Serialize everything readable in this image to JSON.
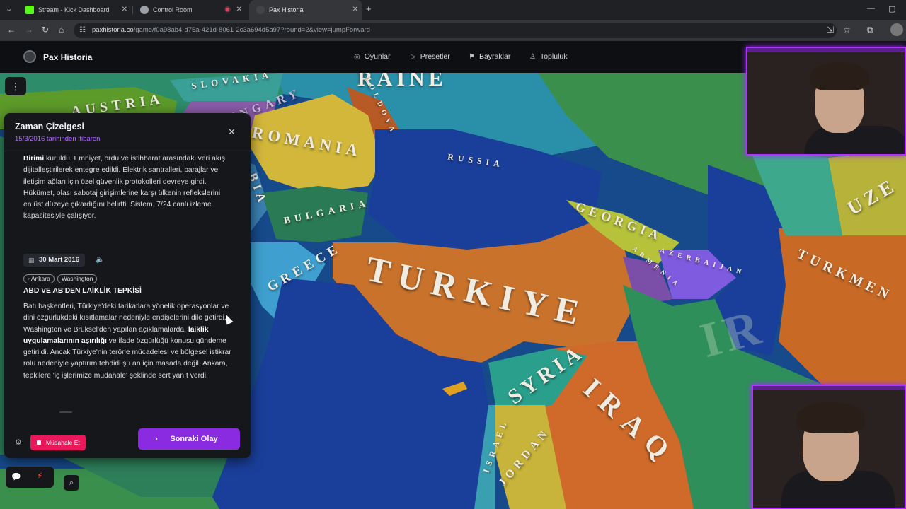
{
  "browser": {
    "tabs": [
      {
        "title": "Stream - Kick Dashboard",
        "favicon_color": "#53fc18"
      },
      {
        "title": "Control Room",
        "favicon_color": "#9aa0a6"
      },
      {
        "title": "Pax Historia",
        "favicon_color": "#444444"
      }
    ],
    "url_host": "paxhistoria.co",
    "url_path": "/game/f0a98ab4-d75a-421d-8061-2c3a694d5a97?round=2&view=jumpForward"
  },
  "app": {
    "brand": "Pax Historia",
    "nav": [
      {
        "label": "Oyunlar",
        "icon": "gamepad-icon"
      },
      {
        "label": "Presetler",
        "icon": "play-icon"
      },
      {
        "label": "Bayraklar",
        "icon": "flag-icon"
      },
      {
        "label": "Topluluk",
        "icon": "users-icon"
      }
    ]
  },
  "map_labels": {
    "ukraine": "RAINE",
    "slovakia": "SLOVAKIA",
    "austria": "AUSTRIA",
    "hungary": "HUNGARY",
    "moldova": "MOLDOVA",
    "romania": "ROMANIA",
    "russia": "RUSSIA",
    "serbia": "BIA",
    "bulgaria": "BULGARIA",
    "georgia": "GEORGIA",
    "armenia": "ARMENIA",
    "azerbaijan": "AZERBAIJAN",
    "greece": "GREECE",
    "turkiye": "TURKIYE",
    "syria": "SYRIA",
    "iraq": "IRAQ",
    "israel": "ISRAEL",
    "jordan": "JORDAN",
    "turkmen": "TURKMEN",
    "uzbek": "UZE",
    "iran": "IR"
  },
  "timeline": {
    "title": "Zaman Çizelgesi",
    "subtitle": "15/3/2016 tarihinden itibaren",
    "prev_event_bold": "Birimi",
    "prev_event_text": " kuruldu. Emniyet, ordu ve istihbarat arasındaki veri akışı dijitalleştirilerek entegre edildi. Elektrik santralleri, barajlar ve iletişim ağları için özel güvenlik protokolleri devreye girdi. Hükümet, olası sabotaj girişimlerine karşı ülkenin reflekslerini en üst düzeye çıkardığını belirtti. Sistem, 7/24 canlı izleme kapasitesiyle çalışıyor.",
    "event_date": "30 Mart 2016",
    "event_tags": [
      "Ankara",
      "Washington"
    ],
    "event_title": "ABD VE AB'DEN LAİKLİK TEPKİSİ",
    "event_text_1": "Batı başkentleri, Türkiye'deki tarikatlara yönelik operasyonlar ve dini özgürlükdeki kısıtlamalar nedeniyle endişelerini dile getirdi. Washington ve Brüksel'den yapılan açıklamalarda, ",
    "event_text_bold": "laiklik uygulamalarının aşırılığı",
    "event_text_2": " ve ifade özgürlüğü konusu gündeme getirildi. Ancak Türkiye'nin terörle mücadelesi ve bölgesel istikrar rolü nedeniyle yaptırım tehdidi şu an için masada değil. Ankara, tepkilere 'iç işlerimize müdahale' şeklinde sert yanıt verdi.",
    "intervene_label": "Müdahale Et",
    "next_label": "Sonraki Olay"
  },
  "colors": {
    "accent_purple": "#8a2be2",
    "intervene_pink": "#e8185a",
    "sea": "#174a8a"
  }
}
